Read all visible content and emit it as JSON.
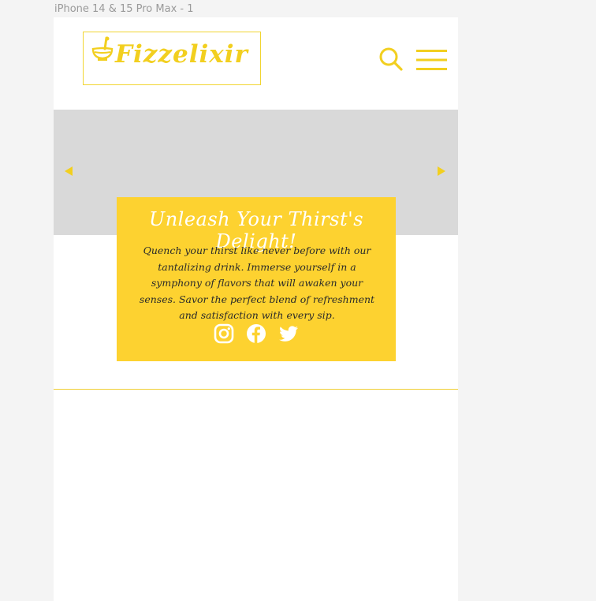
{
  "frame": {
    "label": "iPhone 14 & 15 Pro Max - 1"
  },
  "header": {
    "logo_text": "Fizzelixir",
    "logo_icon": "mortar-pestle-icon",
    "search_icon": "search-icon",
    "menu_icon": "hamburger-menu-icon"
  },
  "hero": {
    "prev_icon": "triangle-left-icon",
    "next_icon": "triangle-right-icon"
  },
  "card": {
    "title": "Unleash Your Thirst's Delight!",
    "body": "Quench your thirst like never before with our tantalizing drink. Immerse yourself in a symphony of flavors that will awaken your senses. Savor the perfect blend of refreshment and satisfaction with every sip.",
    "social_icons": [
      "instagram-icon",
      "facebook-icon",
      "twitter-icon"
    ]
  },
  "colors": {
    "accent": "#f2cf1f",
    "card_background": "#fdd230",
    "hero_background": "#d9d9d9",
    "page_background": "#f4f4f4"
  }
}
